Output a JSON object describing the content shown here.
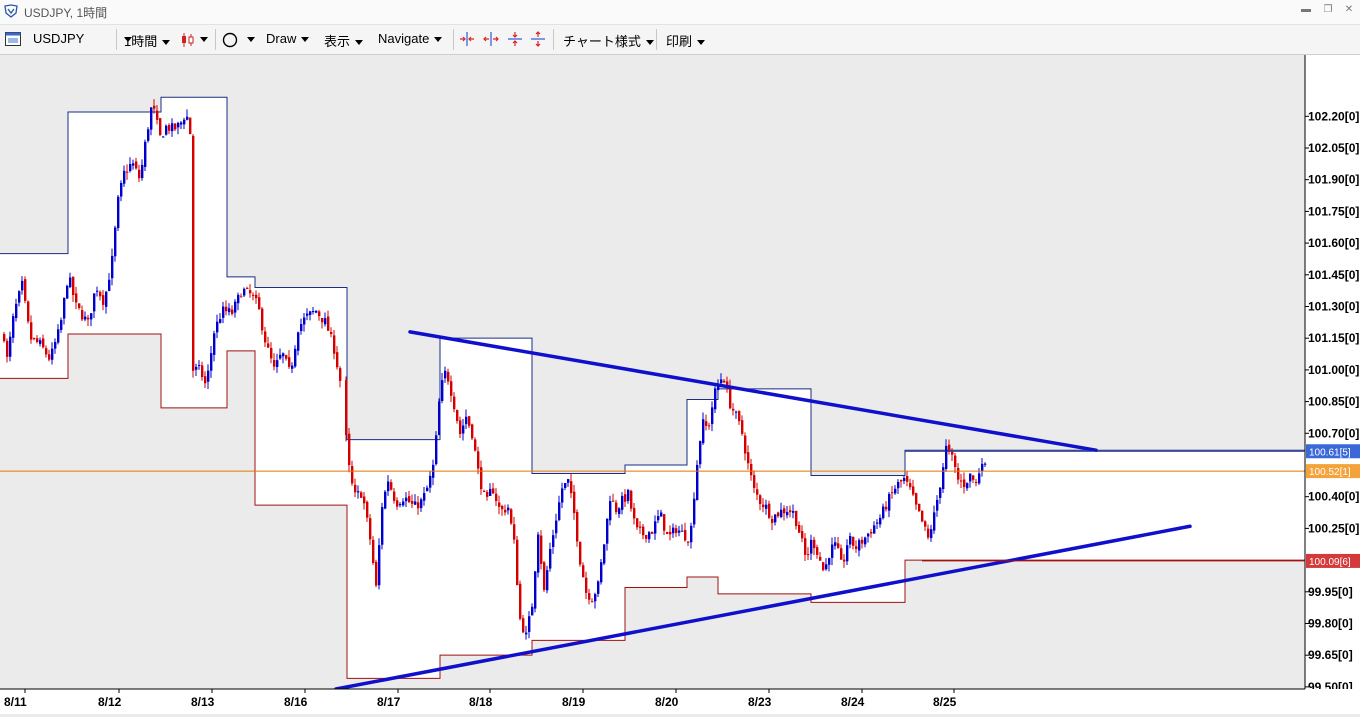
{
  "window": {
    "title": "USDJPY, 1時間"
  },
  "toolbar": {
    "symbol": "USDJPY",
    "timeframe": "1時間",
    "draw": "Draw",
    "display": "表示",
    "navigate": "Navigate",
    "chart_style": "チャート様式",
    "print": "印刷"
  },
  "colors": {
    "up_candle": "#0000cc",
    "down_candle": "#d40000",
    "upper_channel": "#1a2e86",
    "lower_channel": "#a01010",
    "trendline": "#1010cc",
    "price_line": "#e07800",
    "chart_background": "#ffffff"
  },
  "chart_data": {
    "type": "candlestick",
    "x_tick_labels": [
      "8/11",
      "8/12",
      "8/13",
      "8/16",
      "8/17",
      "8/18",
      "8/19",
      "8/20",
      "8/23",
      "8/24",
      "8/25"
    ],
    "y_tick_labels": [
      "102.20[0]",
      "102.05[0]",
      "101.90[0]",
      "101.75[0]",
      "101.60[0]",
      "101.45[0]",
      "101.30[0]",
      "101.15[0]",
      "101.00[0]",
      "100.85[0]",
      "100.70[0]",
      "100.40[0]",
      "100.25[0]",
      "99.95[0]",
      "99.80[0]",
      "99.65[0]",
      "99.50[0]"
    ],
    "ylim": [
      99.49,
      102.49
    ],
    "price_markers": [
      {
        "label": "100.61[5]",
        "value": 100.615,
        "color": "#3a68d8"
      },
      {
        "label": "100.52[1]",
        "value": 100.521,
        "color": "#f4a23a"
      },
      {
        "label": "100.09[6]",
        "value": 100.096,
        "color": "#d43a3a"
      }
    ],
    "current_price": 100.521,
    "daily_channel": {
      "upper": [
        101.55,
        102.22,
        102.29,
        101.44,
        101.39,
        100.67,
        101.15,
        100.51,
        100.55,
        100.86,
        100.91,
        100.5,
        100.62
      ],
      "lower": [
        100.96,
        101.17,
        100.82,
        101.09,
        100.36,
        99.54,
        99.65,
        99.72,
        99.97,
        100.02,
        99.94,
        99.9,
        100.1
      ]
    },
    "trendlines": [
      {
        "name": "resistance",
        "start": {
          "x": "8/17",
          "y": 101.18
        },
        "end": {
          "x": "8/24",
          "y": 100.62
        }
      },
      {
        "name": "support",
        "start": {
          "x": "8/16",
          "y": 99.49
        },
        "end": {
          "x": "8/25",
          "y": 100.26
        }
      }
    ]
  }
}
